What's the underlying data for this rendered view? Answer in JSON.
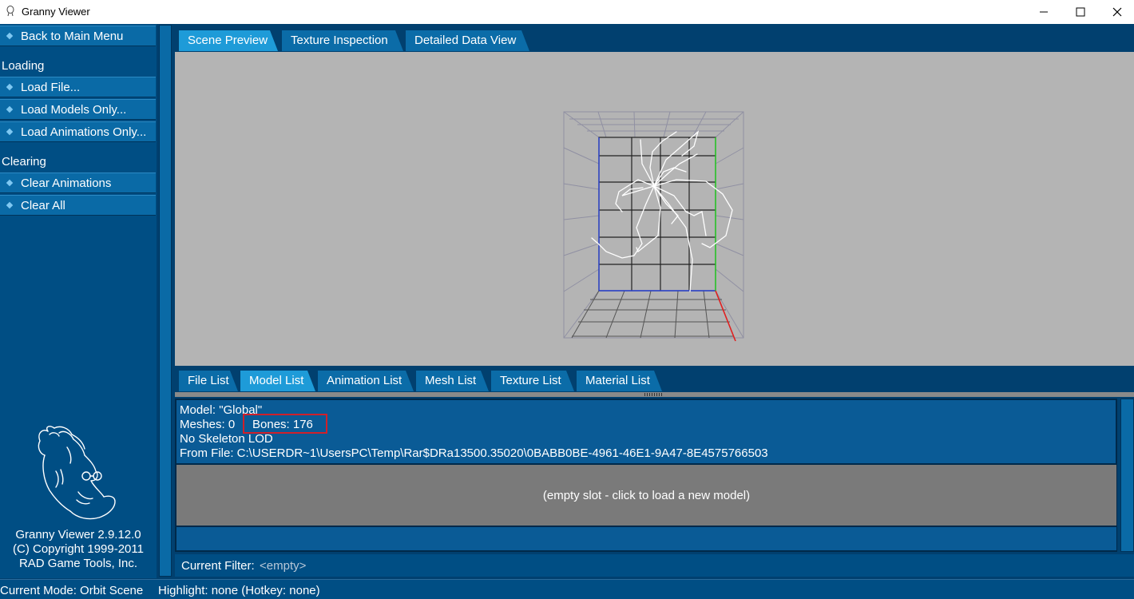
{
  "window": {
    "title": "Granny Viewer"
  },
  "sidebar": {
    "back_label": "Back to Main Menu",
    "loading_header": "Loading",
    "loading_items": [
      {
        "label": "Load File..."
      },
      {
        "label": "Load Models Only..."
      },
      {
        "label": "Load Animations Only..."
      }
    ],
    "clearing_header": "Clearing",
    "clearing_items": [
      {
        "label": "Clear Animations"
      },
      {
        "label": "Clear All"
      }
    ],
    "about": {
      "line1": "Granny Viewer 2.9.12.0",
      "line2": "(C) Copyright 1999-2011",
      "line3": "RAD Game Tools, Inc."
    }
  },
  "top_tabs": [
    {
      "label": "Scene Preview",
      "active": true
    },
    {
      "label": "Texture Inspection",
      "active": false
    },
    {
      "label": "Detailed Data View",
      "active": false
    }
  ],
  "bottom_tabs": [
    {
      "label": "File List",
      "active": false
    },
    {
      "label": "Model List",
      "active": true
    },
    {
      "label": "Animation List",
      "active": false
    },
    {
      "label": "Mesh List",
      "active": false
    },
    {
      "label": "Texture List",
      "active": false
    },
    {
      "label": "Material List",
      "active": false
    }
  ],
  "model_info": {
    "model": "Model: \"Global\"",
    "meshes": "Meshes: 0",
    "bones": "Bones: 176",
    "lod": "No Skeleton LOD",
    "from_file": "From File: C:\\USERDR~1\\UsersPC\\Temp\\Rar$DRa13500.35020\\0BABB0BE-4961-46E1-9A47-8E4575766503"
  },
  "empty_slot": "(empty slot - click to load a new model)",
  "filter": {
    "label": "Current Filter:",
    "value": "<empty>"
  },
  "status": {
    "mode": "Current Mode: Orbit Scene",
    "highlight": "Highlight: none (Hotkey: none)"
  },
  "colors": {
    "background": "#01406f",
    "active_tab": "#1e9bd8",
    "inactive_tab": "#0b6ca8",
    "viewport": "#b4b4b4",
    "highlight_box": "#d0202a"
  }
}
